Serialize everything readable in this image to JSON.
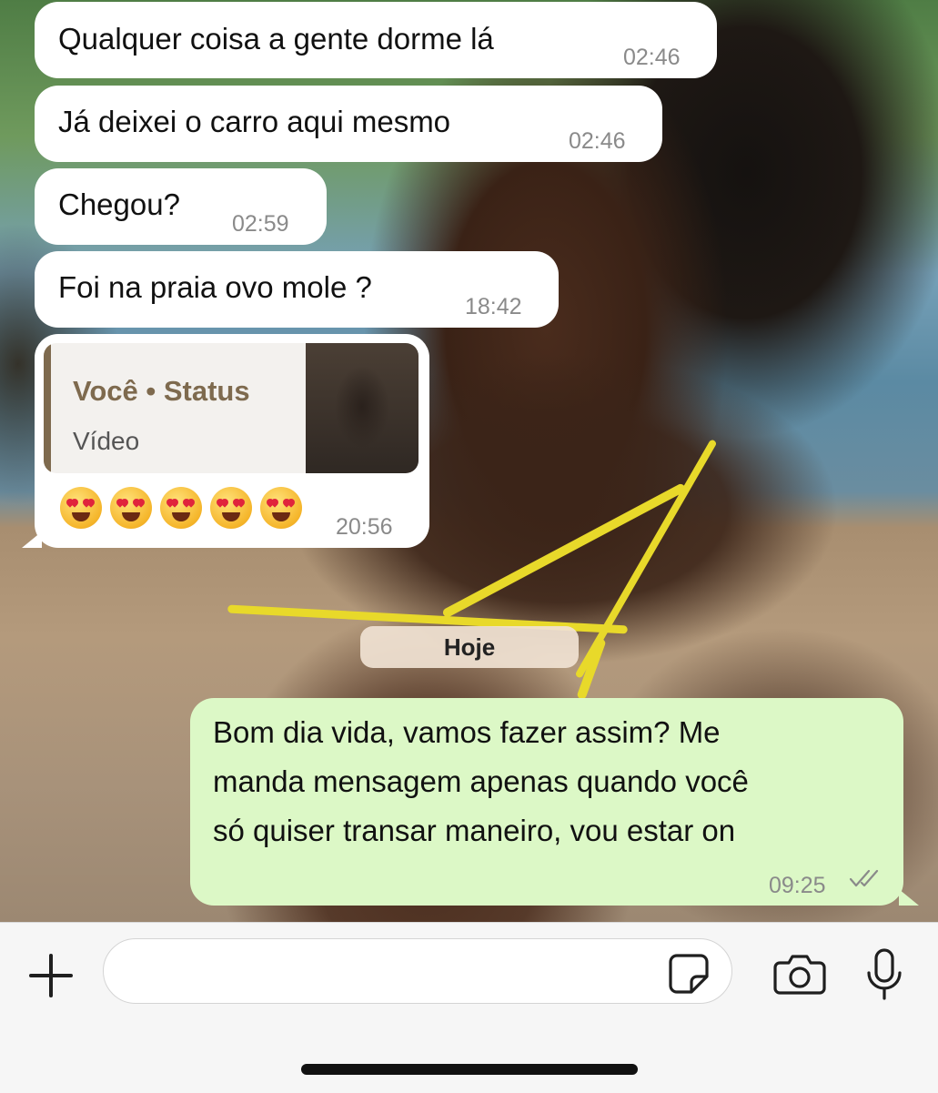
{
  "messages": [
    {
      "direction": "incoming",
      "text": "Qualquer coisa a gente dorme lá",
      "time": "02:46"
    },
    {
      "direction": "incoming",
      "text": "Já deixei o carro aqui mesmo",
      "time": "02:46"
    },
    {
      "direction": "incoming",
      "text": "Chegou?",
      "time": "02:59"
    },
    {
      "direction": "incoming",
      "text": "Foi na praia ovo mole ?",
      "time": "18:42"
    },
    {
      "direction": "incoming",
      "quote": {
        "title": "Você • Status",
        "subtitle": "Vídeo"
      },
      "text": "😍😍😍😍😍",
      "time": "20:56"
    },
    {
      "direction": "outgoing",
      "lines": [
        "Bom dia vida, vamos fazer assim? Me",
        "manda mensagem apenas quando você",
        "só quiser transar maneiro, vou estar on"
      ],
      "time": "09:25",
      "status": "read-double-check"
    }
  ],
  "day_separator": "Hoje",
  "input_bar": {
    "icons": [
      "plus-icon",
      "sticker-icon",
      "camera-icon",
      "microphone-icon"
    ],
    "placeholder": ""
  },
  "colors": {
    "incoming_bubble": "#ffffff",
    "outgoing_bubble": "#dcf8c6",
    "quote_accent": "#7e6a4e",
    "timestamp": "#8a8a8a"
  }
}
